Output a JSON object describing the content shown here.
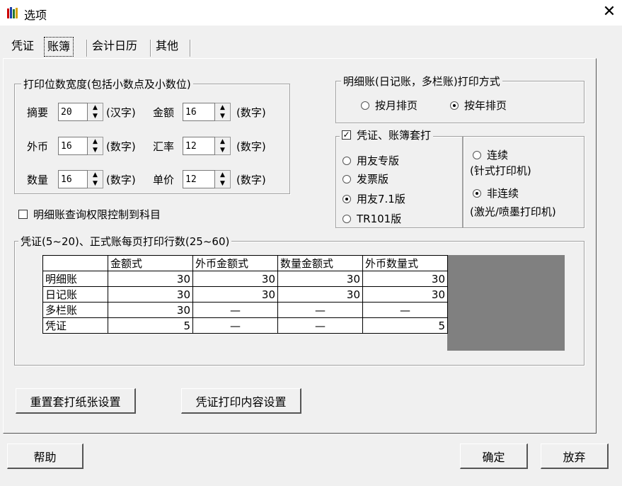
{
  "window": {
    "title": "选项",
    "close_glyph": "✕",
    "icon": "books-icon"
  },
  "tabs": [
    "凭证",
    "账簿",
    "会计日历",
    "其他"
  ],
  "selected_tab": "账簿",
  "print_width": {
    "title": "打印位数宽度(包括小数点及小数位)",
    "rows": [
      {
        "l1": "摘要",
        "v1": "20",
        "u1": "(汉字)",
        "l2": "金额",
        "v2": "16",
        "u2": "(数字)"
      },
      {
        "l1": "外币",
        "v1": "16",
        "u1": "(数字)",
        "l2": "汇率",
        "v2": "12",
        "u2": "(数字)"
      },
      {
        "l1": "数量",
        "v1": "16",
        "u1": "(数字)",
        "l2": "单价",
        "v2": "12",
        "u2": "(数字)"
      }
    ]
  },
  "detail_print": {
    "title": "明细账(日记账，多栏账)打印方式",
    "by_month": "按月排页",
    "by_year": "按年排页",
    "selected": "by_year"
  },
  "overprint": {
    "title": "凭证、账簿套打",
    "checked": true,
    "options": [
      "用友专版",
      "发票版",
      "用友7.1版",
      "TR101版"
    ],
    "selected": "用友7.1版",
    "continuous": "连续",
    "continuous_sub": "(针式打印机)",
    "noncontinuous": "非连续",
    "noncontinuous_sub": "(激光/喷墨打印机)",
    "continuous_selected": "noncontinuous"
  },
  "restrict": {
    "label": "明细账查询权限控制到科目",
    "checked": false
  },
  "lines": {
    "title": "凭证(5~20)、正式账每页打印行数(25~60)",
    "columns": [
      "",
      "金额式",
      "外币金额式",
      "数量金额式",
      "外币数量式"
    ],
    "rows": [
      {
        "name": "明细账",
        "cells": [
          "30",
          "30",
          "30",
          "30"
        ]
      },
      {
        "name": "日记账",
        "cells": [
          "30",
          "30",
          "30",
          "30"
        ]
      },
      {
        "name": "多栏账",
        "cells": [
          "30",
          "—",
          "—",
          "—"
        ]
      },
      {
        "name": "凭证",
        "cells": [
          "5",
          "—",
          "—",
          "5"
        ]
      }
    ]
  },
  "buttons": {
    "reset_paper": "重置套打纸张设置",
    "voucher_content": "凭证打印内容设置",
    "help": "帮助",
    "ok": "确定",
    "cancel": "放弃"
  }
}
